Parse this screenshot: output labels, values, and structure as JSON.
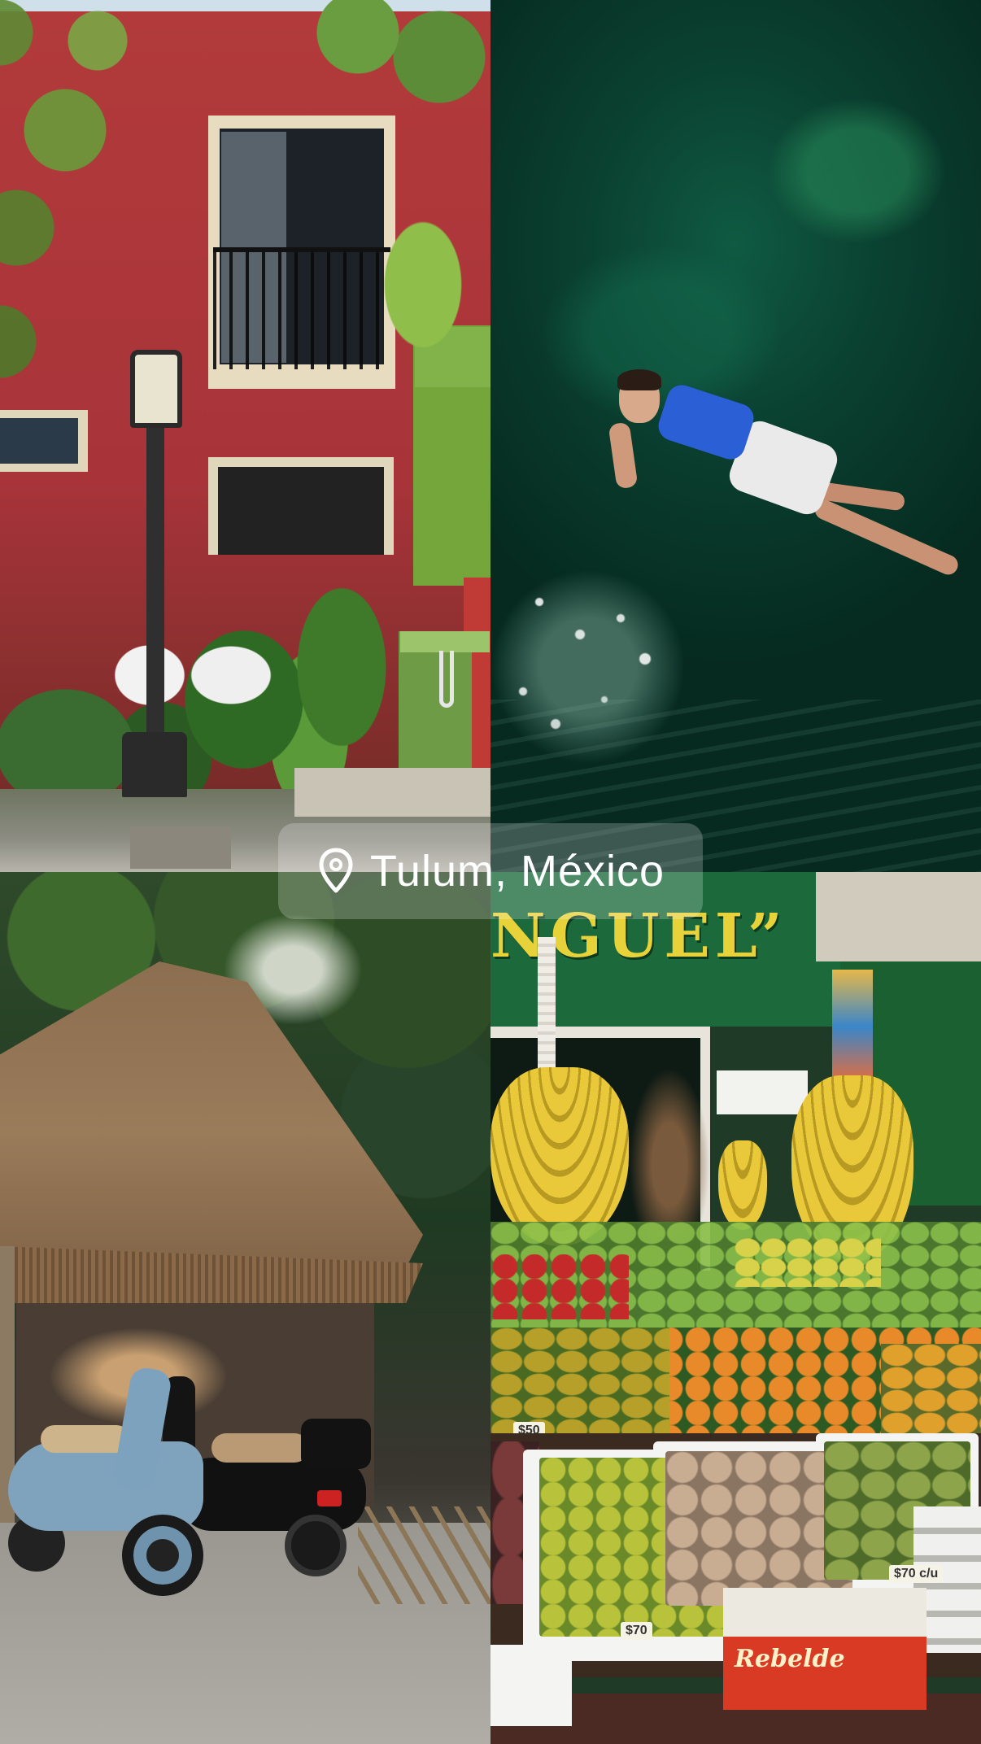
{
  "photos": [
    {
      "name": "red-building",
      "alt": ""
    },
    {
      "name": "swimmer-cenote",
      "alt": ""
    },
    {
      "name": "palapa-scooters",
      "alt": ""
    },
    {
      "name": "fruit-stand",
      "alt": ""
    }
  ],
  "location": {
    "icon": "location-pin-icon",
    "text": "Tulum, México"
  },
  "fruit_stand": {
    "sign_text": "NGUEL”",
    "tag_1": "$50",
    "tag_2": "$70",
    "tag_3": "$70 c/u",
    "box_brand": "Rebelde"
  },
  "colors": {
    "pill_background": "rgba(255,255,255,0.22)",
    "pill_text": "#ffffff",
    "sign_letters": "#e7d23a",
    "sign_background": "#1c6a3c"
  }
}
